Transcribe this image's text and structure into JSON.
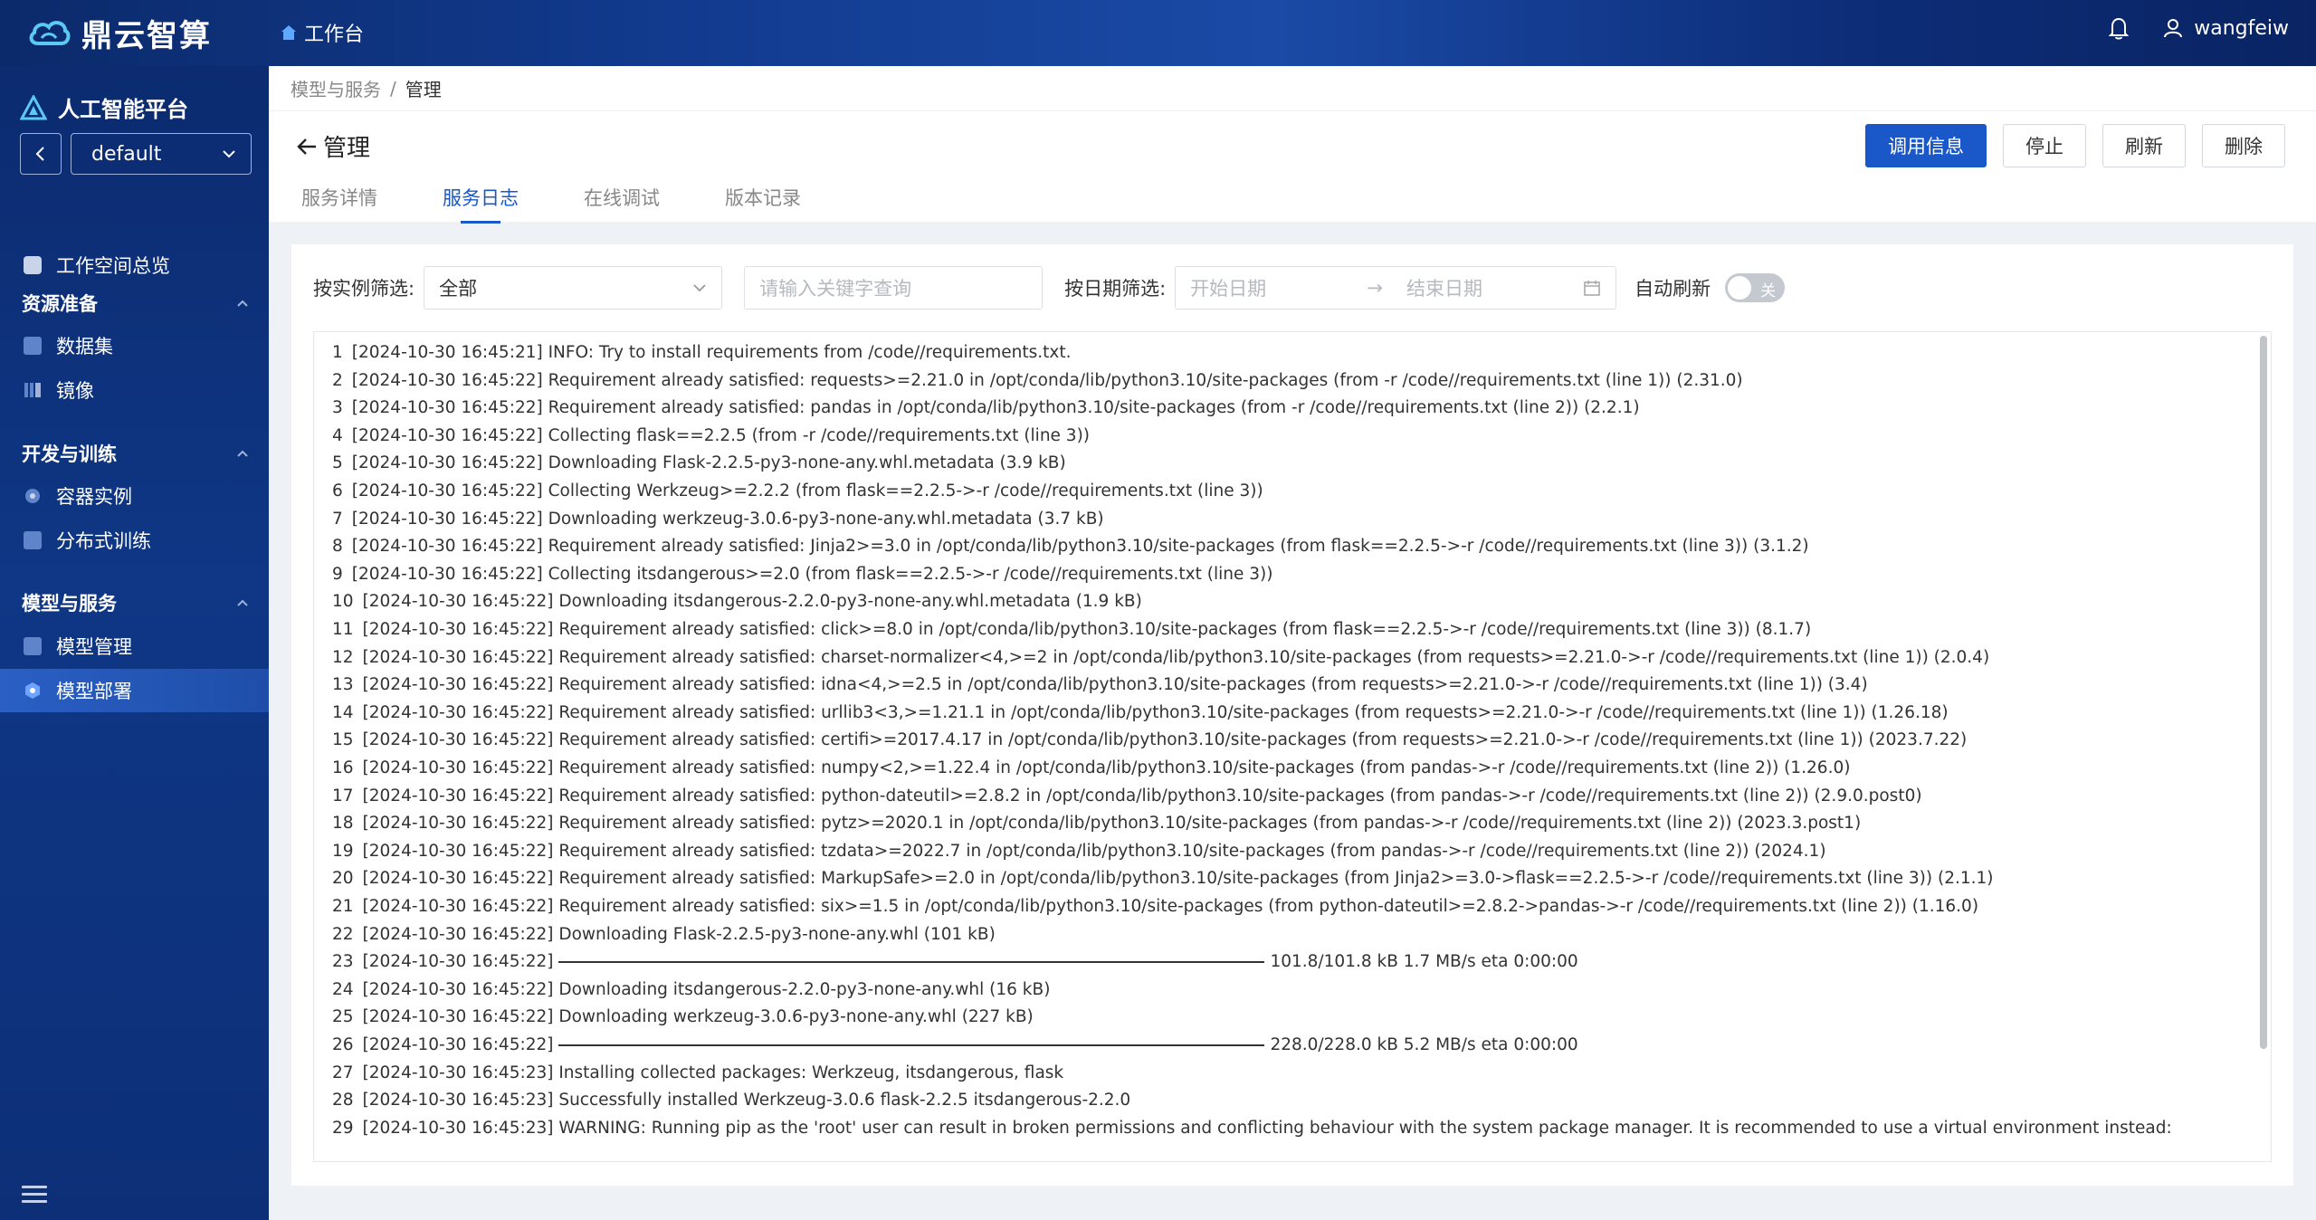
{
  "app": {
    "brand": "鼎云智算",
    "workbench": "工作台",
    "username": "wangfeiw"
  },
  "sidebar": {
    "platform": "人工智能平台",
    "workspace": "default",
    "overview": "工作空间总览",
    "groups": [
      {
        "title": "资源准备",
        "items": [
          "数据集",
          "镜像"
        ]
      },
      {
        "title": "开发与训练",
        "items": [
          "容器实例",
          "分布式训练"
        ]
      },
      {
        "title": "模型与服务",
        "items": [
          "模型管理",
          "模型部署"
        ]
      }
    ],
    "active_item": "模型部署"
  },
  "breadcrumb": {
    "parent": "模型与服务",
    "sep": "/",
    "current": "管理"
  },
  "page": {
    "title": "管理",
    "tabs": [
      "服务详情",
      "服务日志",
      "在线调试",
      "版本记录"
    ],
    "active_tab": "服务日志",
    "actions": {
      "call_info": "调用信息",
      "stop": "停止",
      "refresh": "刷新",
      "delete": "删除"
    }
  },
  "filters": {
    "instance_label": "按实例筛选:",
    "instance_value": "全部",
    "keyword_placeholder": "请输入关键字查询",
    "date_label": "按日期筛选:",
    "start_placeholder": "开始日期",
    "end_placeholder": "结束日期",
    "auto_refresh_label": "自动刷新",
    "auto_refresh_state": "关"
  },
  "log_lines": [
    {
      "n": "1",
      "text": "[2024-10-30 16:45:21] INFO: Try to install requirements from /code//requirements.txt."
    },
    {
      "n": "2",
      "text": "[2024-10-30 16:45:22] Requirement already satisfied: requests>=2.21.0 in /opt/conda/lib/python3.10/site-packages (from -r /code//requirements.txt (line 1)) (2.31.0)"
    },
    {
      "n": "3",
      "text": "[2024-10-30 16:45:22] Requirement already satisfied: pandas in /opt/conda/lib/python3.10/site-packages (from -r /code//requirements.txt (line 2)) (2.2.1)"
    },
    {
      "n": "4",
      "text": "[2024-10-30 16:45:22] Collecting flask==2.2.5 (from -r /code//requirements.txt (line 3))"
    },
    {
      "n": "5",
      "text": "[2024-10-30 16:45:22] Downloading Flask-2.2.5-py3-none-any.whl.metadata (3.9 kB)"
    },
    {
      "n": "6",
      "text": "[2024-10-30 16:45:22] Collecting Werkzeug>=2.2.2 (from flask==2.2.5->-r /code//requirements.txt (line 3))"
    },
    {
      "n": "7",
      "text": "[2024-10-30 16:45:22] Downloading werkzeug-3.0.6-py3-none-any.whl.metadata (3.7 kB)"
    },
    {
      "n": "8",
      "text": "[2024-10-30 16:45:22] Requirement already satisfied: Jinja2>=3.0 in /opt/conda/lib/python3.10/site-packages (from flask==2.2.5->-r /code//requirements.txt (line 3)) (3.1.2)"
    },
    {
      "n": "9",
      "text": "[2024-10-30 16:45:22] Collecting itsdangerous>=2.0 (from flask==2.2.5->-r /code//requirements.txt (line 3))"
    },
    {
      "n": "10",
      "text": "[2024-10-30 16:45:22] Downloading itsdangerous-2.2.0-py3-none-any.whl.metadata (1.9 kB)"
    },
    {
      "n": "11",
      "text": "[2024-10-30 16:45:22] Requirement already satisfied: click>=8.0 in /opt/conda/lib/python3.10/site-packages (from flask==2.2.5->-r /code//requirements.txt (line 3)) (8.1.7)"
    },
    {
      "n": "12",
      "text": "[2024-10-30 16:45:22] Requirement already satisfied: charset-normalizer<4,>=2 in /opt/conda/lib/python3.10/site-packages (from requests>=2.21.0->-r /code//requirements.txt (line 1)) (2.0.4)"
    },
    {
      "n": "13",
      "text": "[2024-10-30 16:45:22] Requirement already satisfied: idna<4,>=2.5 in /opt/conda/lib/python3.10/site-packages (from requests>=2.21.0->-r /code//requirements.txt (line 1)) (3.4)"
    },
    {
      "n": "14",
      "text": "[2024-10-30 16:45:22] Requirement already satisfied: urllib3<3,>=1.21.1 in /opt/conda/lib/python3.10/site-packages (from requests>=2.21.0->-r /code//requirements.txt (line 1)) (1.26.18)"
    },
    {
      "n": "15",
      "text": "[2024-10-30 16:45:22] Requirement already satisfied: certifi>=2017.4.17 in /opt/conda/lib/python3.10/site-packages (from requests>=2.21.0->-r /code//requirements.txt (line 1)) (2023.7.22)"
    },
    {
      "n": "16",
      "text": "[2024-10-30 16:45:22] Requirement already satisfied: numpy<2,>=1.22.4 in /opt/conda/lib/python3.10/site-packages (from pandas->-r /code//requirements.txt (line 2)) (1.26.0)"
    },
    {
      "n": "17",
      "text": "[2024-10-30 16:45:22] Requirement already satisfied: python-dateutil>=2.8.2 in /opt/conda/lib/python3.10/site-packages (from pandas->-r /code//requirements.txt (line 2)) (2.9.0.post0)"
    },
    {
      "n": "18",
      "text": "[2024-10-30 16:45:22] Requirement already satisfied: pytz>=2020.1 in /opt/conda/lib/python3.10/site-packages (from pandas->-r /code//requirements.txt (line 2)) (2023.3.post1)"
    },
    {
      "n": "19",
      "text": "[2024-10-30 16:45:22] Requirement already satisfied: tzdata>=2022.7 in /opt/conda/lib/python3.10/site-packages (from pandas->-r /code//requirements.txt (line 2)) (2024.1)"
    },
    {
      "n": "20",
      "text": "[2024-10-30 16:45:22] Requirement already satisfied: MarkupSafe>=2.0 in /opt/conda/lib/python3.10/site-packages (from Jinja2>=3.0->flask==2.2.5->-r /code//requirements.txt (line 3)) (2.1.1)"
    },
    {
      "n": "21",
      "text": "[2024-10-30 16:45:22] Requirement already satisfied: six>=1.5 in /opt/conda/lib/python3.10/site-packages (from python-dateutil>=2.8.2->pandas->-r /code//requirements.txt (line 2)) (1.16.0)"
    },
    {
      "n": "22",
      "text": "[2024-10-30 16:45:22] Downloading Flask-2.2.5-py3-none-any.whl (101 kB)"
    },
    {
      "n": "23",
      "text": "[2024-10-30 16:45:22]",
      "bar": true,
      "tail": "101.8/101.8 kB 1.7 MB/s eta 0:00:00"
    },
    {
      "n": "24",
      "text": "[2024-10-30 16:45:22] Downloading itsdangerous-2.2.0-py3-none-any.whl (16 kB)"
    },
    {
      "n": "25",
      "text": "[2024-10-30 16:45:22] Downloading werkzeug-3.0.6-py3-none-any.whl (227 kB)"
    },
    {
      "n": "26",
      "text": "[2024-10-30 16:45:22]",
      "bar": true,
      "tail": "228.0/228.0 kB 5.2 MB/s eta 0:00:00"
    },
    {
      "n": "27",
      "text": "[2024-10-30 16:45:23] Installing collected packages: Werkzeug, itsdangerous, flask"
    },
    {
      "n": "28",
      "text": "[2024-10-30 16:45:23] Successfully installed Werkzeug-3.0.6 flask-2.2.5 itsdangerous-2.2.0"
    },
    {
      "n": "29",
      "text": "[2024-10-30 16:45:23] WARNING: Running pip as the 'root' user can result in broken permissions and conflicting behaviour with the system package manager. It is recommended to use a virtual environment instead:"
    }
  ]
}
